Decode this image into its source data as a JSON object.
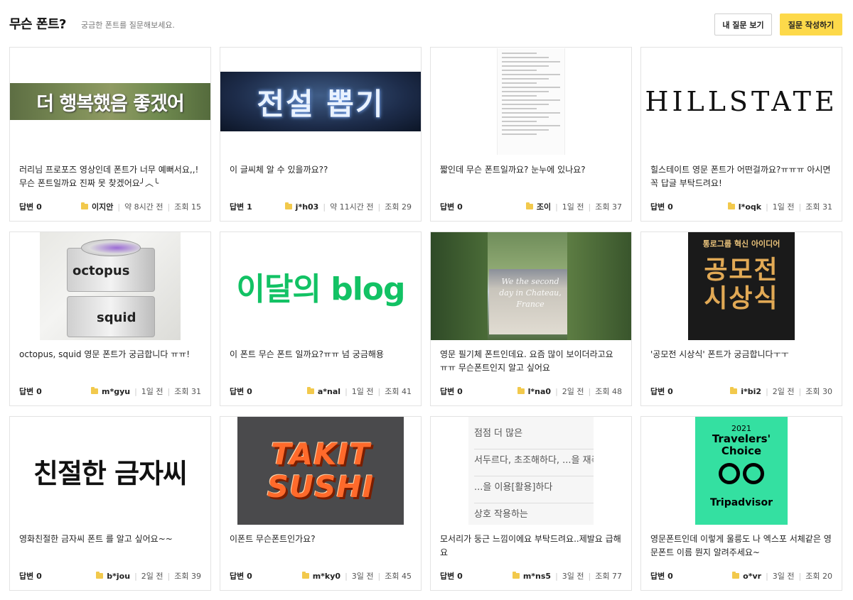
{
  "header": {
    "title": "무슨 폰트?",
    "subtitle": "궁금한 폰트를 질문해보세요.",
    "my_questions_label": "내 질문 보기",
    "write_question_label": "질문 작성하기"
  },
  "cards": [
    {
      "image_text": "더 행복했음 좋겠어",
      "question": "러리님 프로포즈 영상인데 폰트가 너무 예뻐서요,,! 무슨 폰트일까요 진짜 못 찾겠어요╯︿╰",
      "answers": "답변 0",
      "author": "이지안",
      "time": "약 8시간 전",
      "views": "조회 15"
    },
    {
      "image_text": "전설 뽑기",
      "question": "이 글씨체 알 수 있을까요??",
      "answers": "답변 1",
      "author": "j*h03",
      "time": "약 11시간 전",
      "views": "조회 29"
    },
    {
      "image_text": "",
      "question": "짧인데 무슨 폰트일까요? 눈누에 있나요?",
      "answers": "답변 0",
      "author": "조이",
      "time": "1일 전",
      "views": "조회 37"
    },
    {
      "image_text": "HILLSTATE",
      "question": "힐스테이트 영문 폰트가 어떤걸까요?ㅠㅠㅠ 아시면 꼭 답글 부탁드려요!",
      "answers": "답변 0",
      "author": "l*oqk",
      "time": "1일 전",
      "views": "조회 31"
    },
    {
      "image_text_1": "octopus",
      "image_text_2": "squid",
      "question": "octopus, squid 영문 폰트가 궁금합니다 ㅠㅠ!",
      "answers": "답변 0",
      "author": "m*gyu",
      "time": "1일 전",
      "views": "조회 31"
    },
    {
      "image_text": "이달의 blog",
      "question": "이 폰트 무슨 폰트 일까요?ㅠㅠ 넘 궁금해용",
      "answers": "답변 0",
      "author": "a*nal",
      "time": "1일 전",
      "views": "조회 41"
    },
    {
      "image_text": "We the second day in Chateau, France",
      "question": "영문 필기체 폰트인데요. 요즘 많이 보이더라고요 ㅠㅠ 무슨폰트인지 알고 싶어요",
      "answers": "답변 0",
      "author": "l*na0",
      "time": "2일 전",
      "views": "조회 48"
    },
    {
      "image_text_top": "통로그룹 혁신 아이디어",
      "image_text_1": "공모전",
      "image_text_2": "시상식",
      "question": "'공모전 시상식' 폰트가 궁금합니다ㅜㅜ",
      "answers": "답변 0",
      "author": "i*bi2",
      "time": "2일 전",
      "views": "조회 30"
    },
    {
      "image_text": "친절한 금자씨",
      "question": "영화친절한 금자씨 폰트 를 알고 싶어요~~",
      "answers": "답변 0",
      "author": "b*jou",
      "time": "2일 전",
      "views": "조회 39"
    },
    {
      "image_text_1": "TAKIT",
      "image_text_2": "SUSHI",
      "question": "이폰트 무슨폰트인가요?",
      "answers": "답변 0",
      "author": "m*ky0",
      "time": "3일 전",
      "views": "조회 45"
    },
    {
      "image_rows": [
        "점점 더 많은",
        "서두르다, 초조해하다, ...을 재촉",
        "...을 이용[활용]하다",
        "상호 작용하는"
      ],
      "question": "모서리가 둥근 느낌이에요 부탁드려요..제발요 급해요",
      "answers": "답변 0",
      "author": "m*ns5",
      "time": "3일 전",
      "views": "조회 77"
    },
    {
      "image_year": "2021",
      "image_title": "Travelers' Choice",
      "image_brand": "Tripadvisor",
      "question": "영문폰트인데 이렇게 울릉도 나 엑스포 서체같은 영문폰트 이름 뭔지 알려주세요~",
      "answers": "답변 0",
      "author": "o*vr",
      "time": "3일 전",
      "views": "조회 20"
    }
  ]
}
